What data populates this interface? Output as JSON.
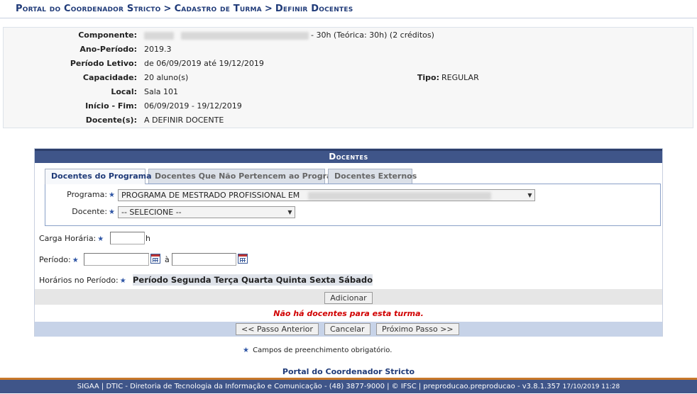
{
  "breadcrumb": {
    "items": [
      "Portal do Coordenador Stricto",
      "Cadastro de Turma",
      "Definir Docentes"
    ],
    "separator": ">"
  },
  "info": {
    "componente_label": "Componente:",
    "componente_suffix": "- 30h (Teórica: 30h) (2 créditos)",
    "ano_periodo_label": "Ano-Período:",
    "ano_periodo_value": "2019.3",
    "periodo_letivo_label": "Período Letivo:",
    "periodo_letivo_value": "de 06/09/2019 até 19/12/2019",
    "capacidade_label": "Capacidade:",
    "capacidade_value": "20 aluno(s)",
    "tipo_label": "Tipo:",
    "tipo_value": "REGULAR",
    "local_label": "Local:",
    "local_value": "Sala 101",
    "inicio_fim_label": "Início - Fim:",
    "inicio_fim_value": "06/09/2019 - 19/12/2019",
    "docentes_label": "Docente(s):",
    "docentes_value": "A DEFINIR DOCENTE"
  },
  "panel": {
    "title": "Docentes",
    "tabs": [
      {
        "label": "Docentes do Programa",
        "active": true
      },
      {
        "label": "Docentes Que Não Pertencem ao Programa",
        "active": false
      },
      {
        "label": "Docentes Externos",
        "active": false
      }
    ],
    "programa_label": "Programa:",
    "programa_value": "PROGRAMA DE MESTRADO PROFISSIONAL EM",
    "docente_label": "Docente:",
    "docente_value": "-- SELECIONE --",
    "carga_label": "Carga Horária:",
    "carga_unit": "h",
    "periodo_label": "Período:",
    "periodo_sep": "à",
    "horarios_label": "Horários no Período:",
    "horarios_headers": [
      "Período",
      "Segunda",
      "Terça",
      "Quarta",
      "Quinta",
      "Sexta",
      "Sábado"
    ],
    "add_button": "Adicionar",
    "empty_message": "Não há docentes para esta turma.",
    "prev_button": "<< Passo Anterior",
    "cancel_button": "Cancelar",
    "next_button": "Próximo Passo >>"
  },
  "required_note": "Campos de preenchimento obrigatório.",
  "portal_link": "Portal do Coordenador Stricto",
  "footer": {
    "text": "SIGAA | DTIC - Diretoria de Tecnologia da Informação e Comunicação - (48) 3877-9000 | © IFSC | preproducao.preproducao - v3.8.1.357",
    "timestamp": "17/10/2019 11:28"
  },
  "colors": {
    "header_blue": "#3f5589",
    "breadcrumb_text": "#1f3a78",
    "error_red": "#d10000",
    "footer_accent": "#c8782a"
  },
  "icons": {
    "required": "star-icon",
    "calendar": "calendar-icon",
    "dropdown": "chevron-down-icon"
  }
}
